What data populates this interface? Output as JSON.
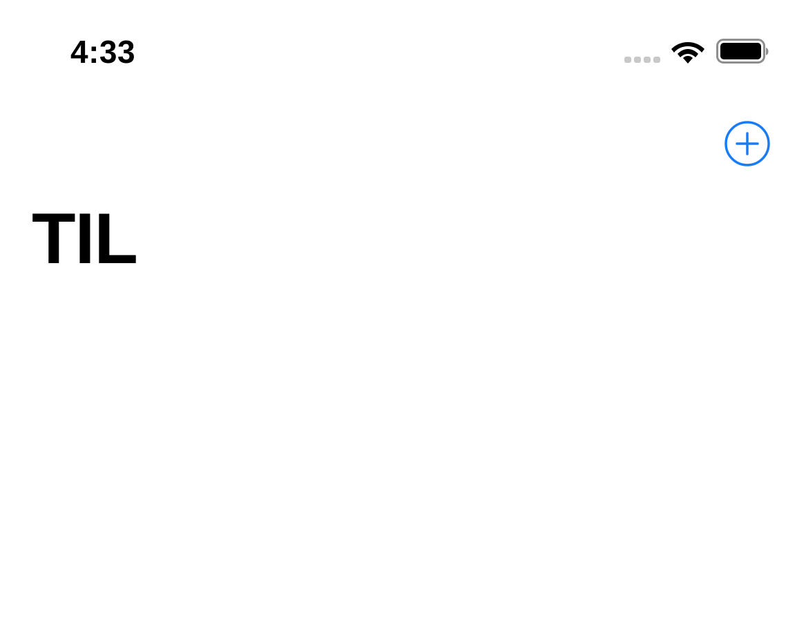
{
  "status_bar": {
    "time": "4:33",
    "signal_icon": "cellular-signal-empty",
    "wifi_icon": "wifi-full",
    "battery_icon": "battery-full"
  },
  "nav": {
    "add_icon": "plus-circle-icon",
    "accent_color": "#1a7cf5"
  },
  "main": {
    "title": "TIL"
  }
}
